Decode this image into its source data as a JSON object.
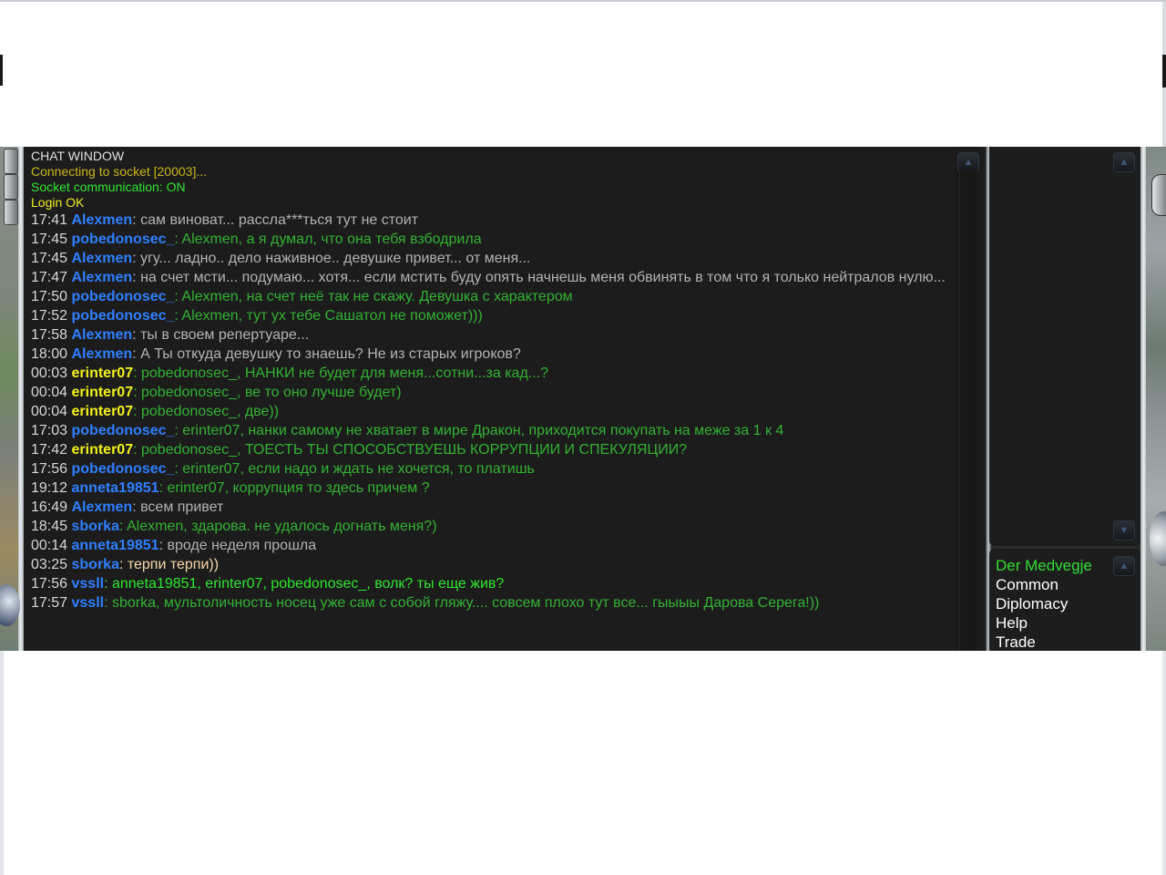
{
  "chat": {
    "system": [
      {
        "text": "CHAT WINDOW",
        "color": "#e0e0e0"
      },
      {
        "text": "Connecting to socket [20003]...",
        "color": "#c8b818"
      },
      {
        "text": "Socket communication: ON",
        "color": "#2ee62e"
      },
      {
        "text": "Login OK",
        "color": "#f0f020"
      }
    ],
    "messages": [
      {
        "time": "17:41",
        "nick": "Alexmen",
        "nick_color": "#2f7fff",
        "text": "сам виноват... рассла***ться тут не стоит",
        "text_color": "#b3b3b3"
      },
      {
        "time": "17:45",
        "nick": "pobedonosec_",
        "nick_color": "#2f7fff",
        "text": "Alexmen, а я думал, что она тебя взбодрила",
        "text_color": "#33b233"
      },
      {
        "time": "17:45",
        "nick": "Alexmen",
        "nick_color": "#2f7fff",
        "text": "угу... ладно.. дело наживное.. девушке привет... от меня...",
        "text_color": "#b3b3b3"
      },
      {
        "time": "17:47",
        "nick": "Alexmen",
        "nick_color": "#2f7fff",
        "text": "на счет мсти... подумаю... хотя... если мстить буду опять начнешь меня обвинять в том что я только нейтралов нулю...",
        "text_color": "#b3b3b3"
      },
      {
        "time": "17:50",
        "nick": "pobedonosec_",
        "nick_color": "#2f7fff",
        "text": "Alexmen, на счет неё так не скажу. Девушка с характером",
        "text_color": "#33b233"
      },
      {
        "time": "17:52",
        "nick": "pobedonosec_",
        "nick_color": "#2f7fff",
        "text": "Alexmen, тут ух тебе Сашатол не поможет)))",
        "text_color": "#33b233"
      },
      {
        "time": "17:58",
        "nick": "Alexmen",
        "nick_color": "#2f7fff",
        "text": "ты в своем репертуаре...",
        "text_color": "#b3b3b3"
      },
      {
        "time": "18:00",
        "nick": "Alexmen",
        "nick_color": "#2f7fff",
        "text": "А Ты откуда девушку то знаешь? Не из старых игроков?",
        "text_color": "#b3b3b3"
      },
      {
        "time": "00:03",
        "nick": "erinter07",
        "nick_color": "#f2f21a",
        "text": "pobedonosec_, НАНКИ   не будет для меня...сотни...за кад...?",
        "text_color": "#33b233"
      },
      {
        "time": "00:04",
        "nick": "erinter07",
        "nick_color": "#f2f21a",
        "text": "pobedonosec_, ве то оно лучше будет)",
        "text_color": "#33b233"
      },
      {
        "time": "00:04",
        "nick": "erinter07",
        "nick_color": "#f2f21a",
        "text": "pobedonosec_, две))",
        "text_color": "#33b233"
      },
      {
        "time": "17:03",
        "nick": "pobedonosec_",
        "nick_color": "#2f7fff",
        "text": "erinter07, нанки самому не хватает в мире Дракон, приходится покупать на меже за 1 к 4",
        "text_color": "#33b233"
      },
      {
        "time": "17:42",
        "nick": "erinter07",
        "nick_color": "#f2f21a",
        "text": "pobedonosec_, ТОЕСТЬ ТЫ СПОСОБСТВУЕШЬ КОРРУПЦИИ И СПЕКУЛЯЦИИ?",
        "text_color": "#33b233"
      },
      {
        "time": "17:56",
        "nick": "pobedonosec_",
        "nick_color": "#2f7fff",
        "text": "erinter07, если надо и ждать не хочется, то платишь",
        "text_color": "#33b233"
      },
      {
        "time": "19:12",
        "nick": "anneta19851",
        "nick_color": "#2f7fff",
        "text": "erinter07, коррупция то здесь причем ?",
        "text_color": "#33b233"
      },
      {
        "time": "16:49",
        "nick": "Alexmen",
        "nick_color": "#2f7fff",
        "text": "всем привет",
        "text_color": "#b3b3b3"
      },
      {
        "time": "18:45",
        "nick": "sborka",
        "nick_color": "#2f7fff",
        "text": "Alexmen, здарова. не удалось догнать меня?)",
        "text_color": "#33b233"
      },
      {
        "time": "00:14",
        "nick": "anneta19851",
        "nick_color": "#2f7fff",
        "text": "вроде неделя прошла",
        "text_color": "#b3b3b3"
      },
      {
        "time": "03:25",
        "nick": "sborka",
        "nick_color": "#2f7fff",
        "text": "терпи терпи))",
        "text_color": "#f5d7a8"
      },
      {
        "time": "17:56",
        "nick": "vssll",
        "nick_color": "#2f7fff",
        "text": "anneta19851, erinter07, pobedonosec_, волк? ты еще жив?",
        "text_color": "#2ee62e"
      },
      {
        "time": "17:57",
        "nick": "vssll",
        "nick_color": "#2f7fff",
        "text": "sborka, мультоличность носец уже сам с собой гляжу.... совсем плохо тут все... гыыыы Дарова Серега!))",
        "text_color": "#33b233"
      }
    ]
  },
  "channels": [
    {
      "label": "Der Medvegje",
      "active": true
    },
    {
      "label": "Common",
      "active": false
    },
    {
      "label": "Diplomacy",
      "active": false
    },
    {
      "label": "Help",
      "active": false
    },
    {
      "label": "Trade",
      "active": false
    }
  ],
  "icons": {
    "scroll_up": "chevron-up-icon",
    "scroll_down": "chevron-down-icon"
  }
}
